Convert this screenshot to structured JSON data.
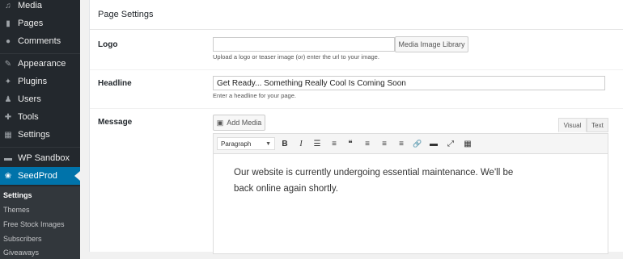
{
  "sidebar": {
    "items": [
      {
        "label": "Media",
        "icon": "media-icon",
        "glyph": "♫"
      },
      {
        "label": "Pages",
        "icon": "pages-icon",
        "glyph": "▮"
      },
      {
        "label": "Comments",
        "icon": "comments-icon",
        "glyph": "●"
      },
      {
        "label": "Appearance",
        "icon": "appearance-icon",
        "glyph": "✎"
      },
      {
        "label": "Plugins",
        "icon": "plugins-icon",
        "glyph": "✦"
      },
      {
        "label": "Users",
        "icon": "users-icon",
        "glyph": "♟"
      },
      {
        "label": "Tools",
        "icon": "tools-icon",
        "glyph": "✚"
      },
      {
        "label": "Settings",
        "icon": "settings-icon",
        "glyph": "▦"
      },
      {
        "label": "WP Sandbox",
        "icon": "sandbox-icon",
        "glyph": "▬"
      },
      {
        "label": "SeedProd",
        "icon": "seedprod-icon",
        "glyph": "❀"
      }
    ],
    "submenu": [
      "Settings",
      "Themes",
      "Free Stock Images",
      "Subscribers",
      "Giveaways"
    ]
  },
  "panel": {
    "title": "Page Settings",
    "logo": {
      "label": "Logo",
      "value": "",
      "button": "Media Image Library",
      "help": "Upload a logo or teaser image (or) enter the url to your image."
    },
    "headline": {
      "label": "Headline",
      "value": "Get Ready... Something Really Cool Is Coming Soon",
      "help": "Enter a headline for your page."
    },
    "message": {
      "label": "Message",
      "add_media": "Add Media",
      "tab_visual": "Visual",
      "tab_text": "Text",
      "format": "Paragraph",
      "content": "Our website is currently undergoing essential maintenance. We'll be back online again shortly."
    }
  },
  "toolbar_buttons": [
    {
      "name": "bold-button",
      "glyph": "B"
    },
    {
      "name": "italic-button",
      "glyph": "I"
    },
    {
      "name": "bullet-list-button",
      "glyph": "☰"
    },
    {
      "name": "numbered-list-button",
      "glyph": "≡"
    },
    {
      "name": "blockquote-button",
      "glyph": "❝"
    },
    {
      "name": "align-left-button",
      "glyph": "≡"
    },
    {
      "name": "align-center-button",
      "glyph": "≡"
    },
    {
      "name": "align-right-button",
      "glyph": "≡"
    },
    {
      "name": "link-button",
      "glyph": "🔗"
    },
    {
      "name": "read-more-button",
      "glyph": "▬"
    },
    {
      "name": "fullscreen-button",
      "glyph": "⤢"
    },
    {
      "name": "toolbar-toggle-button",
      "glyph": "▦"
    }
  ]
}
